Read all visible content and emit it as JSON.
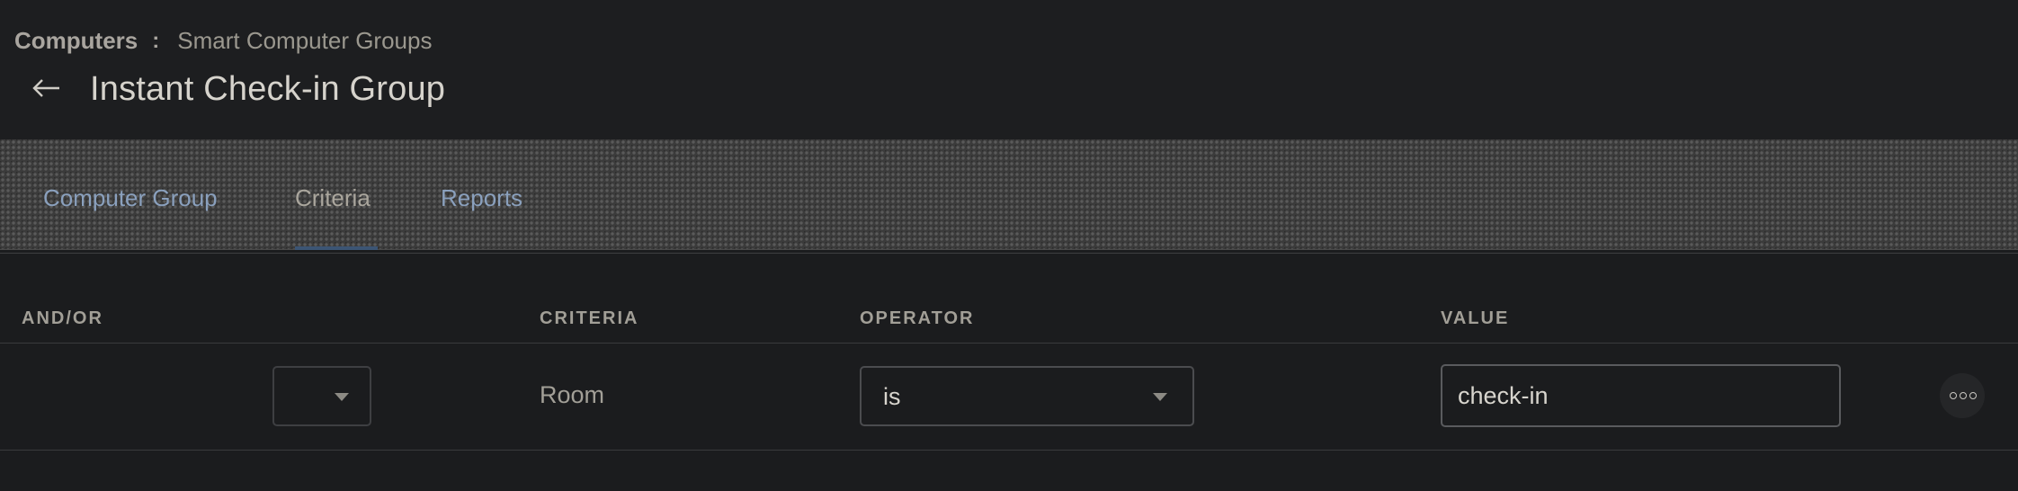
{
  "breadcrumb": {
    "root": "Computers",
    "separator": ":",
    "current": "Smart Computer Groups"
  },
  "header": {
    "title": "Instant Check-in Group",
    "back_icon": "left-arrow-icon"
  },
  "tabs": [
    {
      "label": "Computer Group",
      "active": false
    },
    {
      "label": "Criteria",
      "active": true
    },
    {
      "label": "Reports",
      "active": false
    }
  ],
  "table": {
    "columns": [
      "AND/OR",
      "CRITERIA",
      "OPERATOR",
      "VALUE"
    ],
    "rows": [
      {
        "and_or": "",
        "criteria": "Room",
        "operator": "is",
        "value": "check-in"
      }
    ]
  },
  "icons": {
    "caret": "caret-down-icon",
    "more": "more-options-icon"
  },
  "colors": {
    "background": "#1b1c1e",
    "tab_link": "#8aa0bd",
    "tab_active_underline": "#3c5574"
  }
}
